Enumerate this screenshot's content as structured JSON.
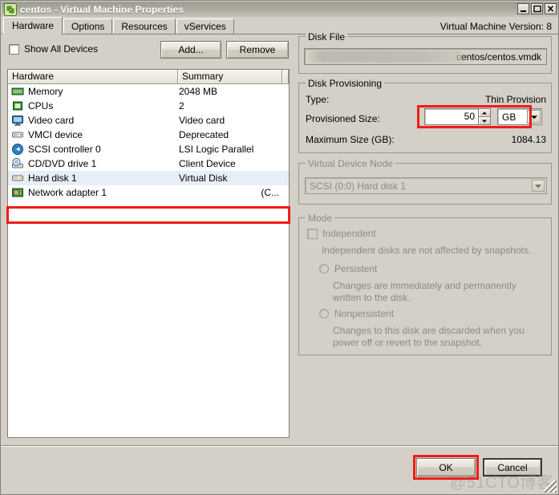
{
  "window": {
    "icon": "vmware-vm-icon",
    "title": "centos - Virtual Machine Properties",
    "minimize_label": "_",
    "maximize_label": "☐",
    "close_label": "✕"
  },
  "tabs": [
    {
      "label": "Hardware",
      "active": true
    },
    {
      "label": "Options",
      "active": false
    },
    {
      "label": "Resources",
      "active": false
    },
    {
      "label": "vServices",
      "active": false
    }
  ],
  "version_text": "Virtual Machine Version: 8",
  "left": {
    "show_all_devices_label": "Show All Devices",
    "add_button": "Add...",
    "remove_button": "Remove",
    "columns": [
      "Hardware",
      "Summary"
    ],
    "rows": [
      {
        "icon": "memory-icon",
        "name": "Memory",
        "summary": "2048 MB",
        "selected": false,
        "right_aligned": false
      },
      {
        "icon": "cpu-icon",
        "name": "CPUs",
        "summary": "2",
        "selected": false,
        "right_aligned": false
      },
      {
        "icon": "video-card-icon",
        "name": "Video card",
        "summary": "Video card",
        "selected": false,
        "right_aligned": false
      },
      {
        "icon": "vmci-device-icon",
        "name": "VMCI device",
        "summary": "Deprecated",
        "selected": false,
        "right_aligned": false
      },
      {
        "icon": "scsi-controller-icon",
        "name": "SCSI controller 0",
        "summary": "LSI Logic Parallel",
        "selected": false,
        "right_aligned": false
      },
      {
        "icon": "cd-dvd-drive-icon",
        "name": "CD/DVD drive 1",
        "summary": "Client Device",
        "selected": false,
        "right_aligned": false
      },
      {
        "icon": "hard-disk-icon",
        "name": "Hard disk 1",
        "summary": "Virtual Disk",
        "selected": true,
        "right_aligned": false
      },
      {
        "icon": "network-adapter-icon",
        "name": "Network adapter 1",
        "summary": "(C...",
        "selected": false,
        "right_aligned": true
      }
    ]
  },
  "right": {
    "disk_file": {
      "group_title": "Disk File",
      "value": "centos/centos.vmdk"
    },
    "disk_provisioning": {
      "group_title": "Disk Provisioning",
      "type_label": "Type:",
      "type_value": "Thin Provision",
      "provisioned_size_label": "Provisioned Size:",
      "provisioned_size_value": "50",
      "unit_value": "GB",
      "maximum_size_label": "Maximum Size (GB):",
      "maximum_size_value": "1084.13"
    },
    "virtual_device_node": {
      "group_title": "Virtual Device Node",
      "value": "SCSI (0:0) Hard disk 1"
    },
    "mode": {
      "group_title": "Mode",
      "independent_label": "Independent",
      "independent_desc": "Independent disks are not affected by snapshots.",
      "persistent_label": "Persistent",
      "persistent_desc": "Changes are immediately and permanently written to the disk.",
      "nonpersistent_label": "Nonpersistent",
      "nonpersistent_desc": "Changes to this disk are discarded when you power off or revert to the snapshot."
    }
  },
  "footer": {
    "ok_button": "OK",
    "cancel_button": "Cancel",
    "watermark": "@51CTO博客"
  },
  "colors": {
    "dialog_face": "#d4d0c8",
    "annotation_red": "#ee1c19",
    "selection_blue": "#e8eef7",
    "title_text": "#ffffff"
  }
}
